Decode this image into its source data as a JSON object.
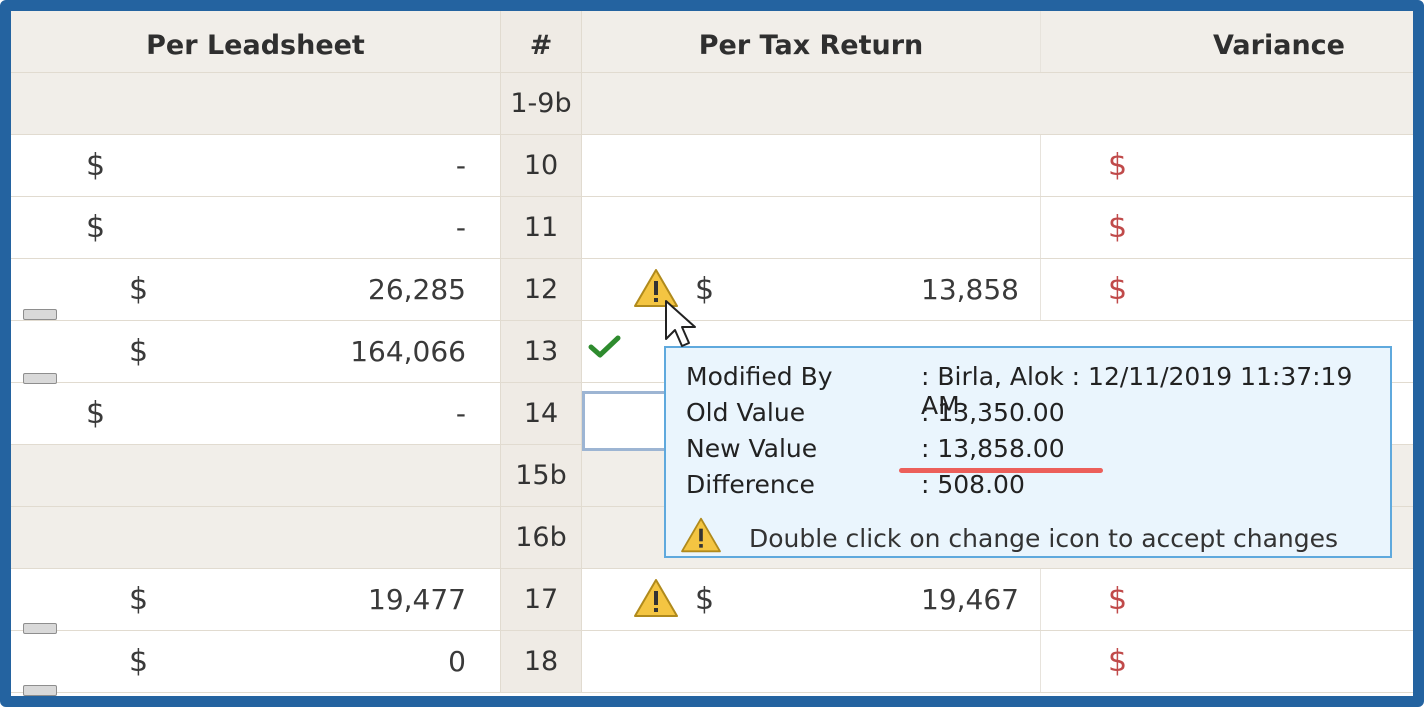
{
  "headers": {
    "per_leadsheet": "Per Leadsheet",
    "num": "#",
    "per_tax_return": "Per Tax Return",
    "variance": "Variance"
  },
  "rows": [
    {
      "num": "1-9b",
      "leadsheet_dollar": "",
      "leadsheet_value": "",
      "tax_dollar": "",
      "tax_value": "",
      "variance_dollar": ""
    },
    {
      "num": "10",
      "leadsheet_dollar": "$",
      "leadsheet_value": "-",
      "tax_dollar": "",
      "tax_value": "",
      "variance_dollar": "$"
    },
    {
      "num": "11",
      "leadsheet_dollar": "$",
      "leadsheet_value": "-",
      "tax_dollar": "",
      "tax_value": "",
      "variance_dollar": "$"
    },
    {
      "num": "12",
      "leadsheet_dollar": "$",
      "leadsheet_value": "26,285",
      "tax_dollar": "$",
      "tax_value": "13,858",
      "variance_dollar": "$"
    },
    {
      "num": "13",
      "leadsheet_dollar": "$",
      "leadsheet_value": "164,066",
      "tax_dollar": "",
      "tax_value": "",
      "variance_dollar": ""
    },
    {
      "num": "14",
      "leadsheet_dollar": "$",
      "leadsheet_value": "-",
      "tax_dollar": "",
      "tax_value": "",
      "variance_dollar": ""
    },
    {
      "num": "15b",
      "leadsheet_dollar": "",
      "leadsheet_value": "",
      "tax_dollar": "",
      "tax_value": "",
      "variance_dollar": ""
    },
    {
      "num": "16b",
      "leadsheet_dollar": "",
      "leadsheet_value": "",
      "tax_dollar": "",
      "tax_value": "",
      "variance_dollar": ""
    },
    {
      "num": "17",
      "leadsheet_dollar": "$",
      "leadsheet_value": "19,477",
      "tax_dollar": "$",
      "tax_value": "19,467",
      "variance_dollar": "$"
    },
    {
      "num": "18",
      "leadsheet_dollar": "$",
      "leadsheet_value": "0",
      "tax_dollar": "",
      "tax_value": "",
      "variance_dollar": "$"
    }
  ],
  "tooltip": {
    "modified_by_label": "Modified By",
    "modified_by_value": ": Birla, Alok : 12/11/2019 11:37:19 AM",
    "old_value_label": "Old Value",
    "old_value": ": 13,350.00",
    "new_value_label": "New Value",
    "new_value": ": 13,858.00",
    "difference_label": "Difference",
    "difference_value": ": 508.00",
    "message": "Double click on change icon to accept changes"
  },
  "icons": {
    "warning": "warning-triangle-icon",
    "check": "checkmark-icon",
    "cursor": "mouse-pointer-icon",
    "collapse": "collapse-toggle-icon"
  },
  "colors": {
    "frame": "#2463a0",
    "header_bg": "#f1eee9",
    "variance_dollar": "#c04a4a",
    "warning_fill": "#f4c542",
    "check": "#2e8b2e",
    "tooltip_bg": "#eaf5fd",
    "tooltip_border": "#5fa9dd",
    "underline": "#ec5f5a"
  }
}
